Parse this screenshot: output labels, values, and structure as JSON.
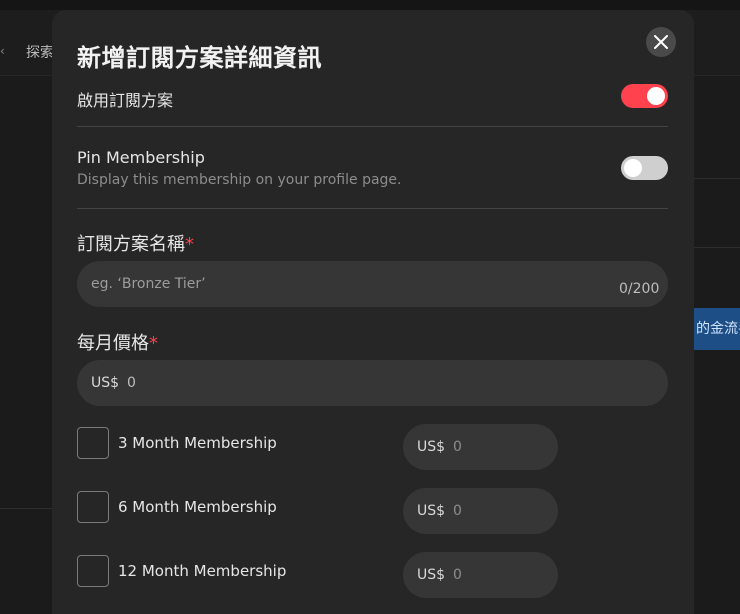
{
  "background": {
    "nav_chevron": "‹",
    "nav_explore": "探索",
    "blue_button_text": "的金流手"
  },
  "modal": {
    "title": "新增訂閱方案詳細資訊",
    "enable": {
      "label": "啟用訂閱方案",
      "state": "on"
    },
    "pin": {
      "label": "Pin Membership",
      "description": "Display this membership on your profile page.",
      "state": "off"
    },
    "name": {
      "label": "訂閱方案名稱",
      "required_mark": "*",
      "placeholder": "eg. ‘Bronze Tier’",
      "counter": "0/200"
    },
    "price": {
      "label": "每月價格",
      "required_mark": "*",
      "currency": "US$",
      "placeholder": "0"
    },
    "multi_month": [
      {
        "label": "3 Month Membership",
        "currency": "US$",
        "placeholder": "0"
      },
      {
        "label": "6 Month Membership",
        "currency": "US$",
        "placeholder": "0"
      },
      {
        "label": "12 Month Membership",
        "currency": "US$",
        "placeholder": "0"
      }
    ]
  },
  "colors": {
    "accent": "#ff424d",
    "modal_bg": "#262626",
    "input_bg": "#363636"
  }
}
